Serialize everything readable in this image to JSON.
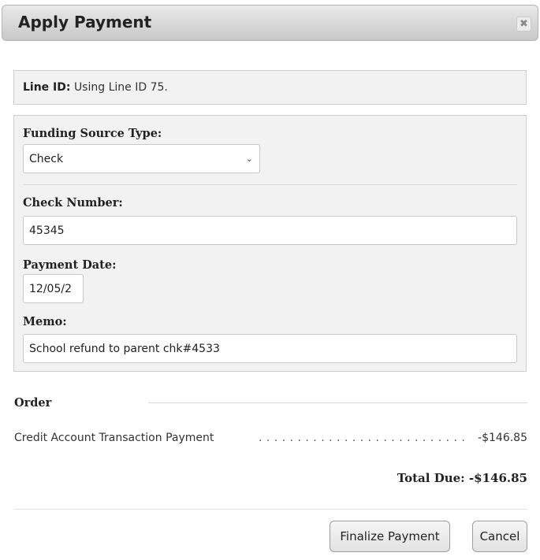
{
  "dialog": {
    "title": "Apply Payment",
    "close_icon": "close-icon"
  },
  "line_id": {
    "label": "Line ID:",
    "value": "Using Line ID 75."
  },
  "form": {
    "funding_source_type": {
      "label": "Funding Source Type:",
      "selected": "Check"
    },
    "check_number": {
      "label": "Check Number:",
      "value": "45345"
    },
    "payment_date": {
      "label": "Payment Date:",
      "value": "12/05/2"
    },
    "memo": {
      "label": "Memo:",
      "value": "School refund to parent chk#4533"
    }
  },
  "order": {
    "heading": "Order",
    "items": [
      {
        "name": "Credit Account Transaction Payment",
        "leader": ". . . . . . . . . . . . . . . . . . . . . . . . . . . . . .",
        "amount": "-$146.85"
      }
    ],
    "total": "Total Due: -$146.85"
  },
  "buttons": {
    "finalize": "Finalize Payment",
    "cancel": "Cancel"
  }
}
